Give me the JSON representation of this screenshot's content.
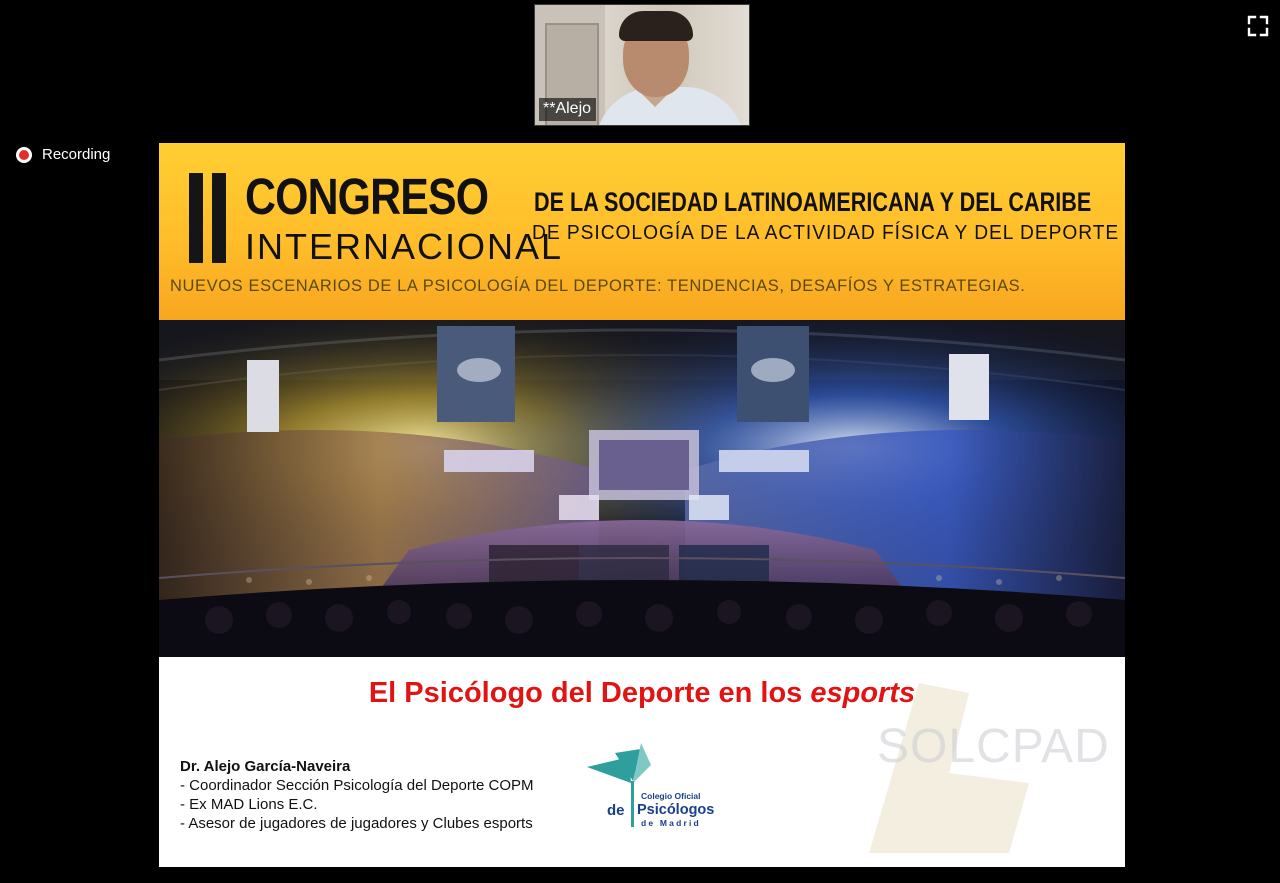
{
  "meeting": {
    "participant_name": "**Alejo",
    "recording_label": "Recording"
  },
  "slide": {
    "banner": {
      "roman_numeral": "II",
      "title_line1": "CONGRESO",
      "title_line2": "INTERNACIONAL",
      "society_line1": "DE LA SOCIEDAD LATINOAMERICANA Y DEL CARIBE",
      "society_line2": "DE PSICOLOGÍA DE LA ACTIVIDAD FÍSICA Y DEL DEPORTE",
      "tagline": "NUEVOS ESCENARIOS  DE LA PSICOLOGÍA  DEL DEPORTE:  TENDENCIAS,    DESAFÍOS Y ESTRATEGIAS."
    },
    "talk_title_main": "El Psicólogo del Deporte en los ",
    "talk_title_italic": "esports",
    "speaker": {
      "name": "Dr. Alejo García-Naveira",
      "lines": [
        "- Coordinador Sección Psicología del Deporte COPM",
        "- Ex MAD Lions E.C.",
        "- Asesor de jugadores de jugadores y Clubes esports"
      ]
    },
    "logo": {
      "line1": "Colegio Oficial",
      "line2_prefix": "de",
      "line2": "Psicólogos",
      "line3": "de Madrid"
    },
    "watermark_text": "SOLCPAD"
  },
  "colors": {
    "banner": "#ffc22e",
    "title_red": "#e11414",
    "logo_teal": "#2e9f9c",
    "logo_blue": "#1a3f8f"
  }
}
